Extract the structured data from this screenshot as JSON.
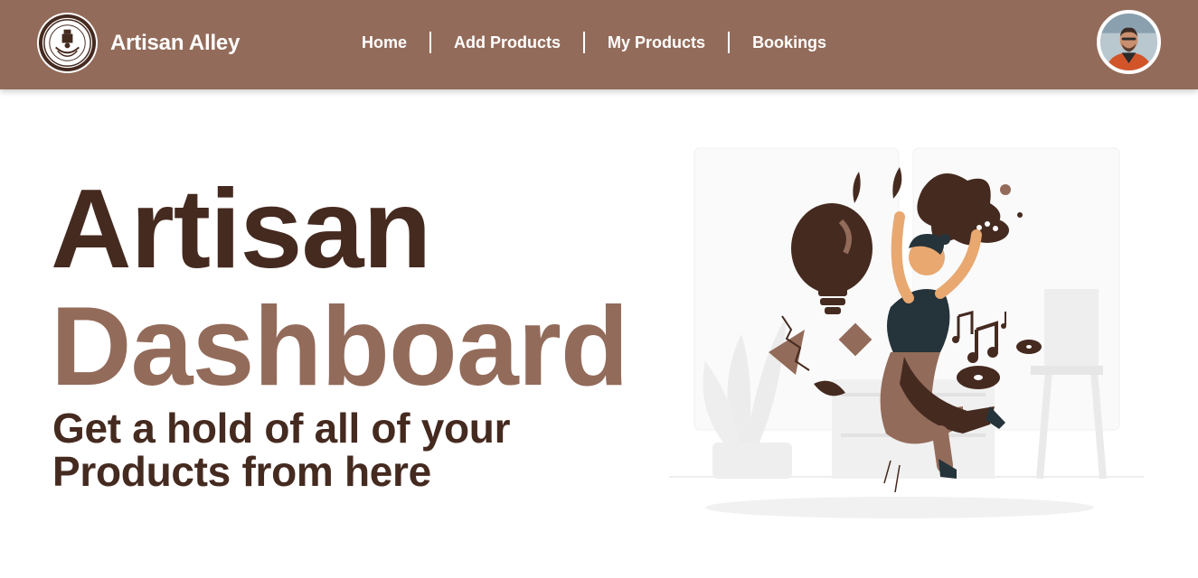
{
  "brand": {
    "name": "Artisan Alley",
    "logo_icon": "artisan-alley-seal-logo"
  },
  "nav": {
    "links": [
      {
        "label": "Home"
      },
      {
        "label": "Add Products"
      },
      {
        "label": "My Products"
      },
      {
        "label": "Bookings"
      }
    ]
  },
  "user": {
    "avatar_icon": "user-avatar-photo"
  },
  "hero": {
    "title_line1": "Artisan",
    "title_line2": "Dashboard",
    "subtitle": "Get a hold of all of your Products from here",
    "illustration_icon": "jumping-artist-illustration"
  },
  "colors": {
    "navbar": "#936b5a",
    "dark_brown": "#452a20",
    "accent_brown": "#936b5a",
    "white": "#ffffff"
  }
}
